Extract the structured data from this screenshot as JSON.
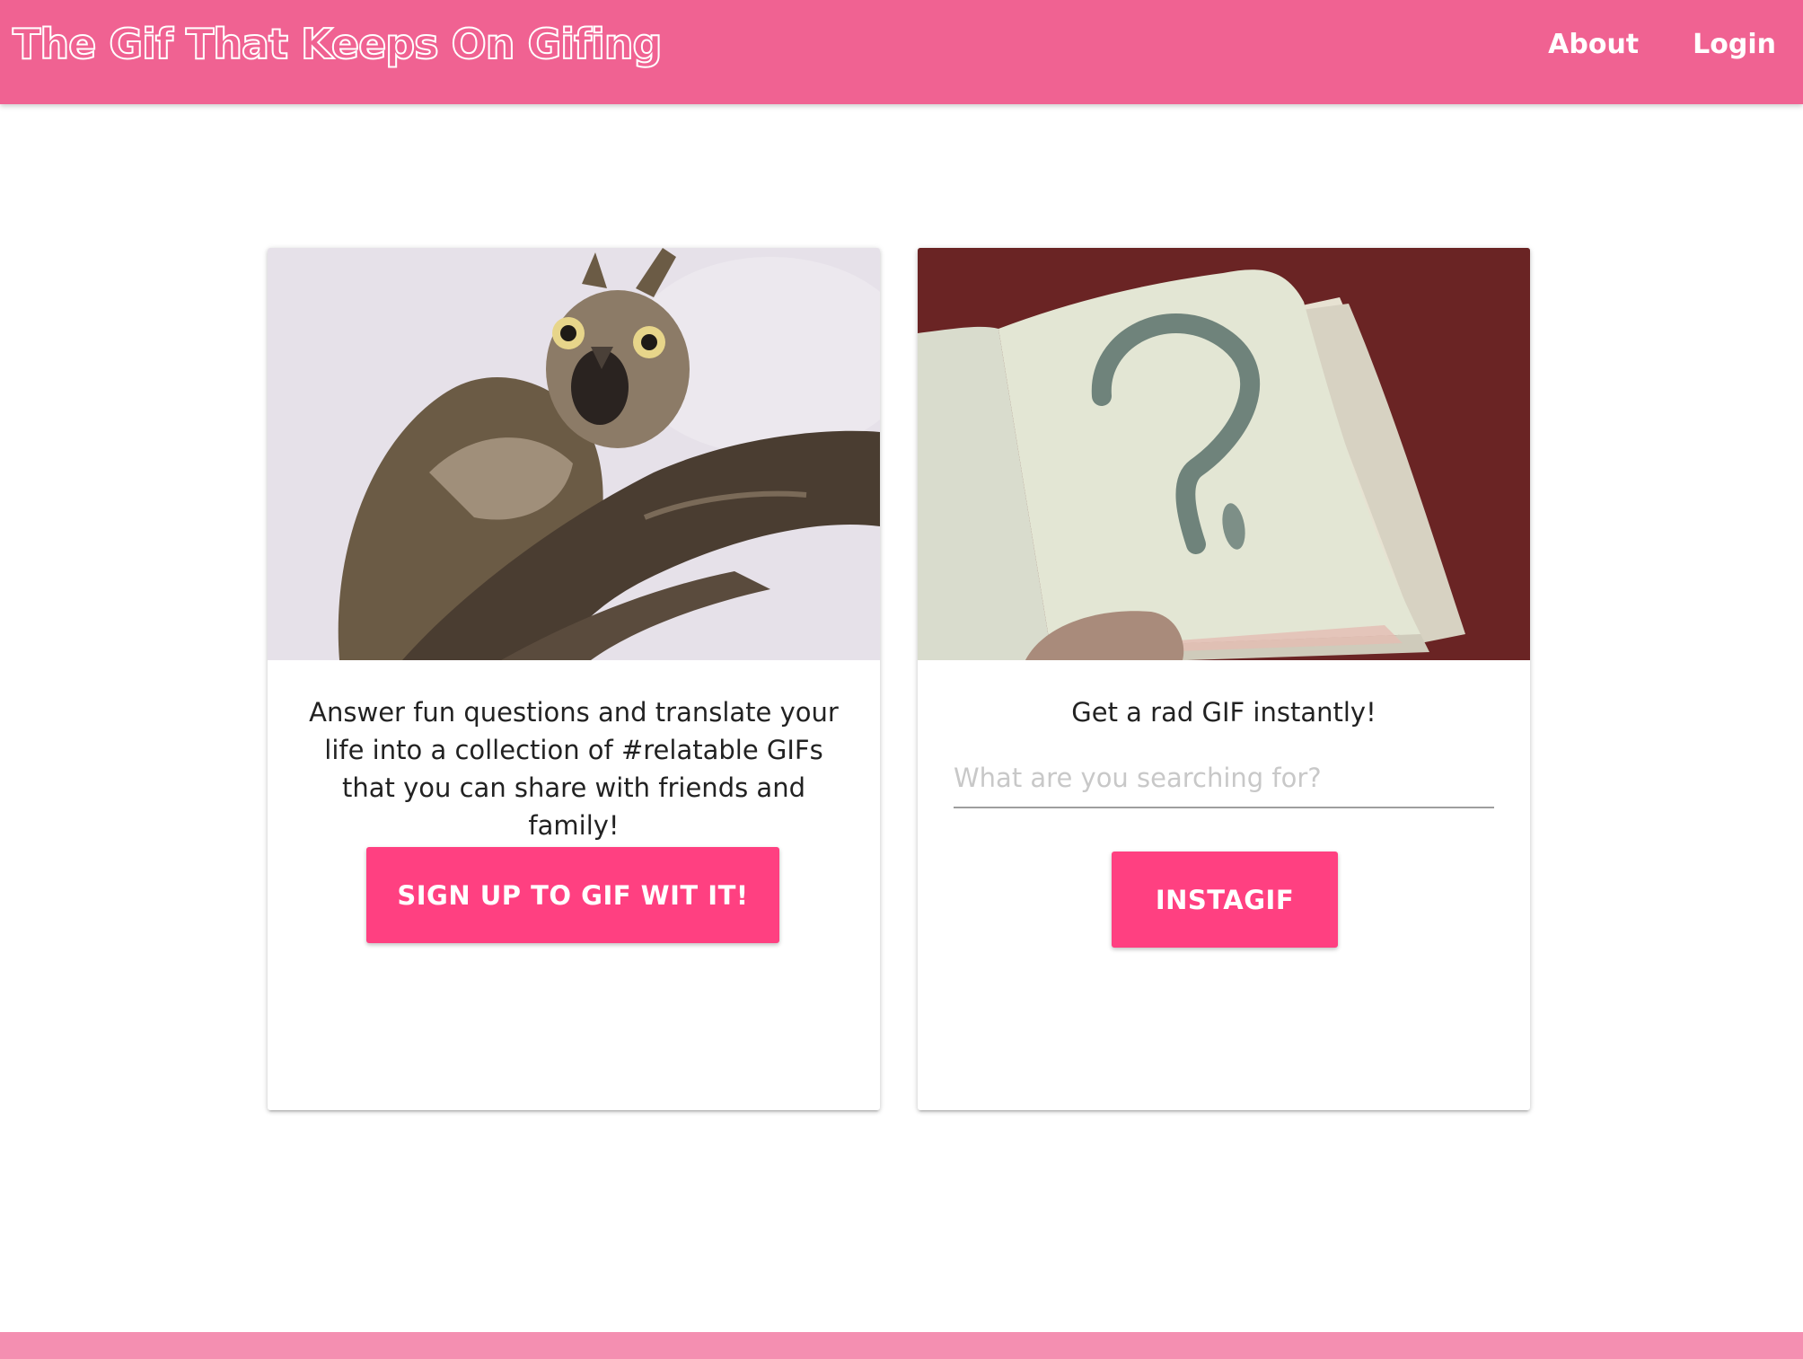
{
  "header": {
    "brand": "The Gif That Keeps On Gifing",
    "nav": {
      "about": "About",
      "login": "Login"
    }
  },
  "colors": {
    "navbar": "#f06292",
    "accent_button": "#ff4081",
    "footer": "#f48fb1"
  },
  "cards": {
    "signup": {
      "image": "owl-gif-image",
      "text": "Answer fun questions and translate your life into a collection of #relatable GIFs that you can share with friends and family!",
      "button": "SIGN UP TO GIF WIT IT!"
    },
    "instant": {
      "image": "question-mark-book-gif-image",
      "heading": "Get a rad GIF instantly!",
      "search_placeholder": "What are you searching for?",
      "search_value": "",
      "button": "INSTAGIF"
    }
  }
}
